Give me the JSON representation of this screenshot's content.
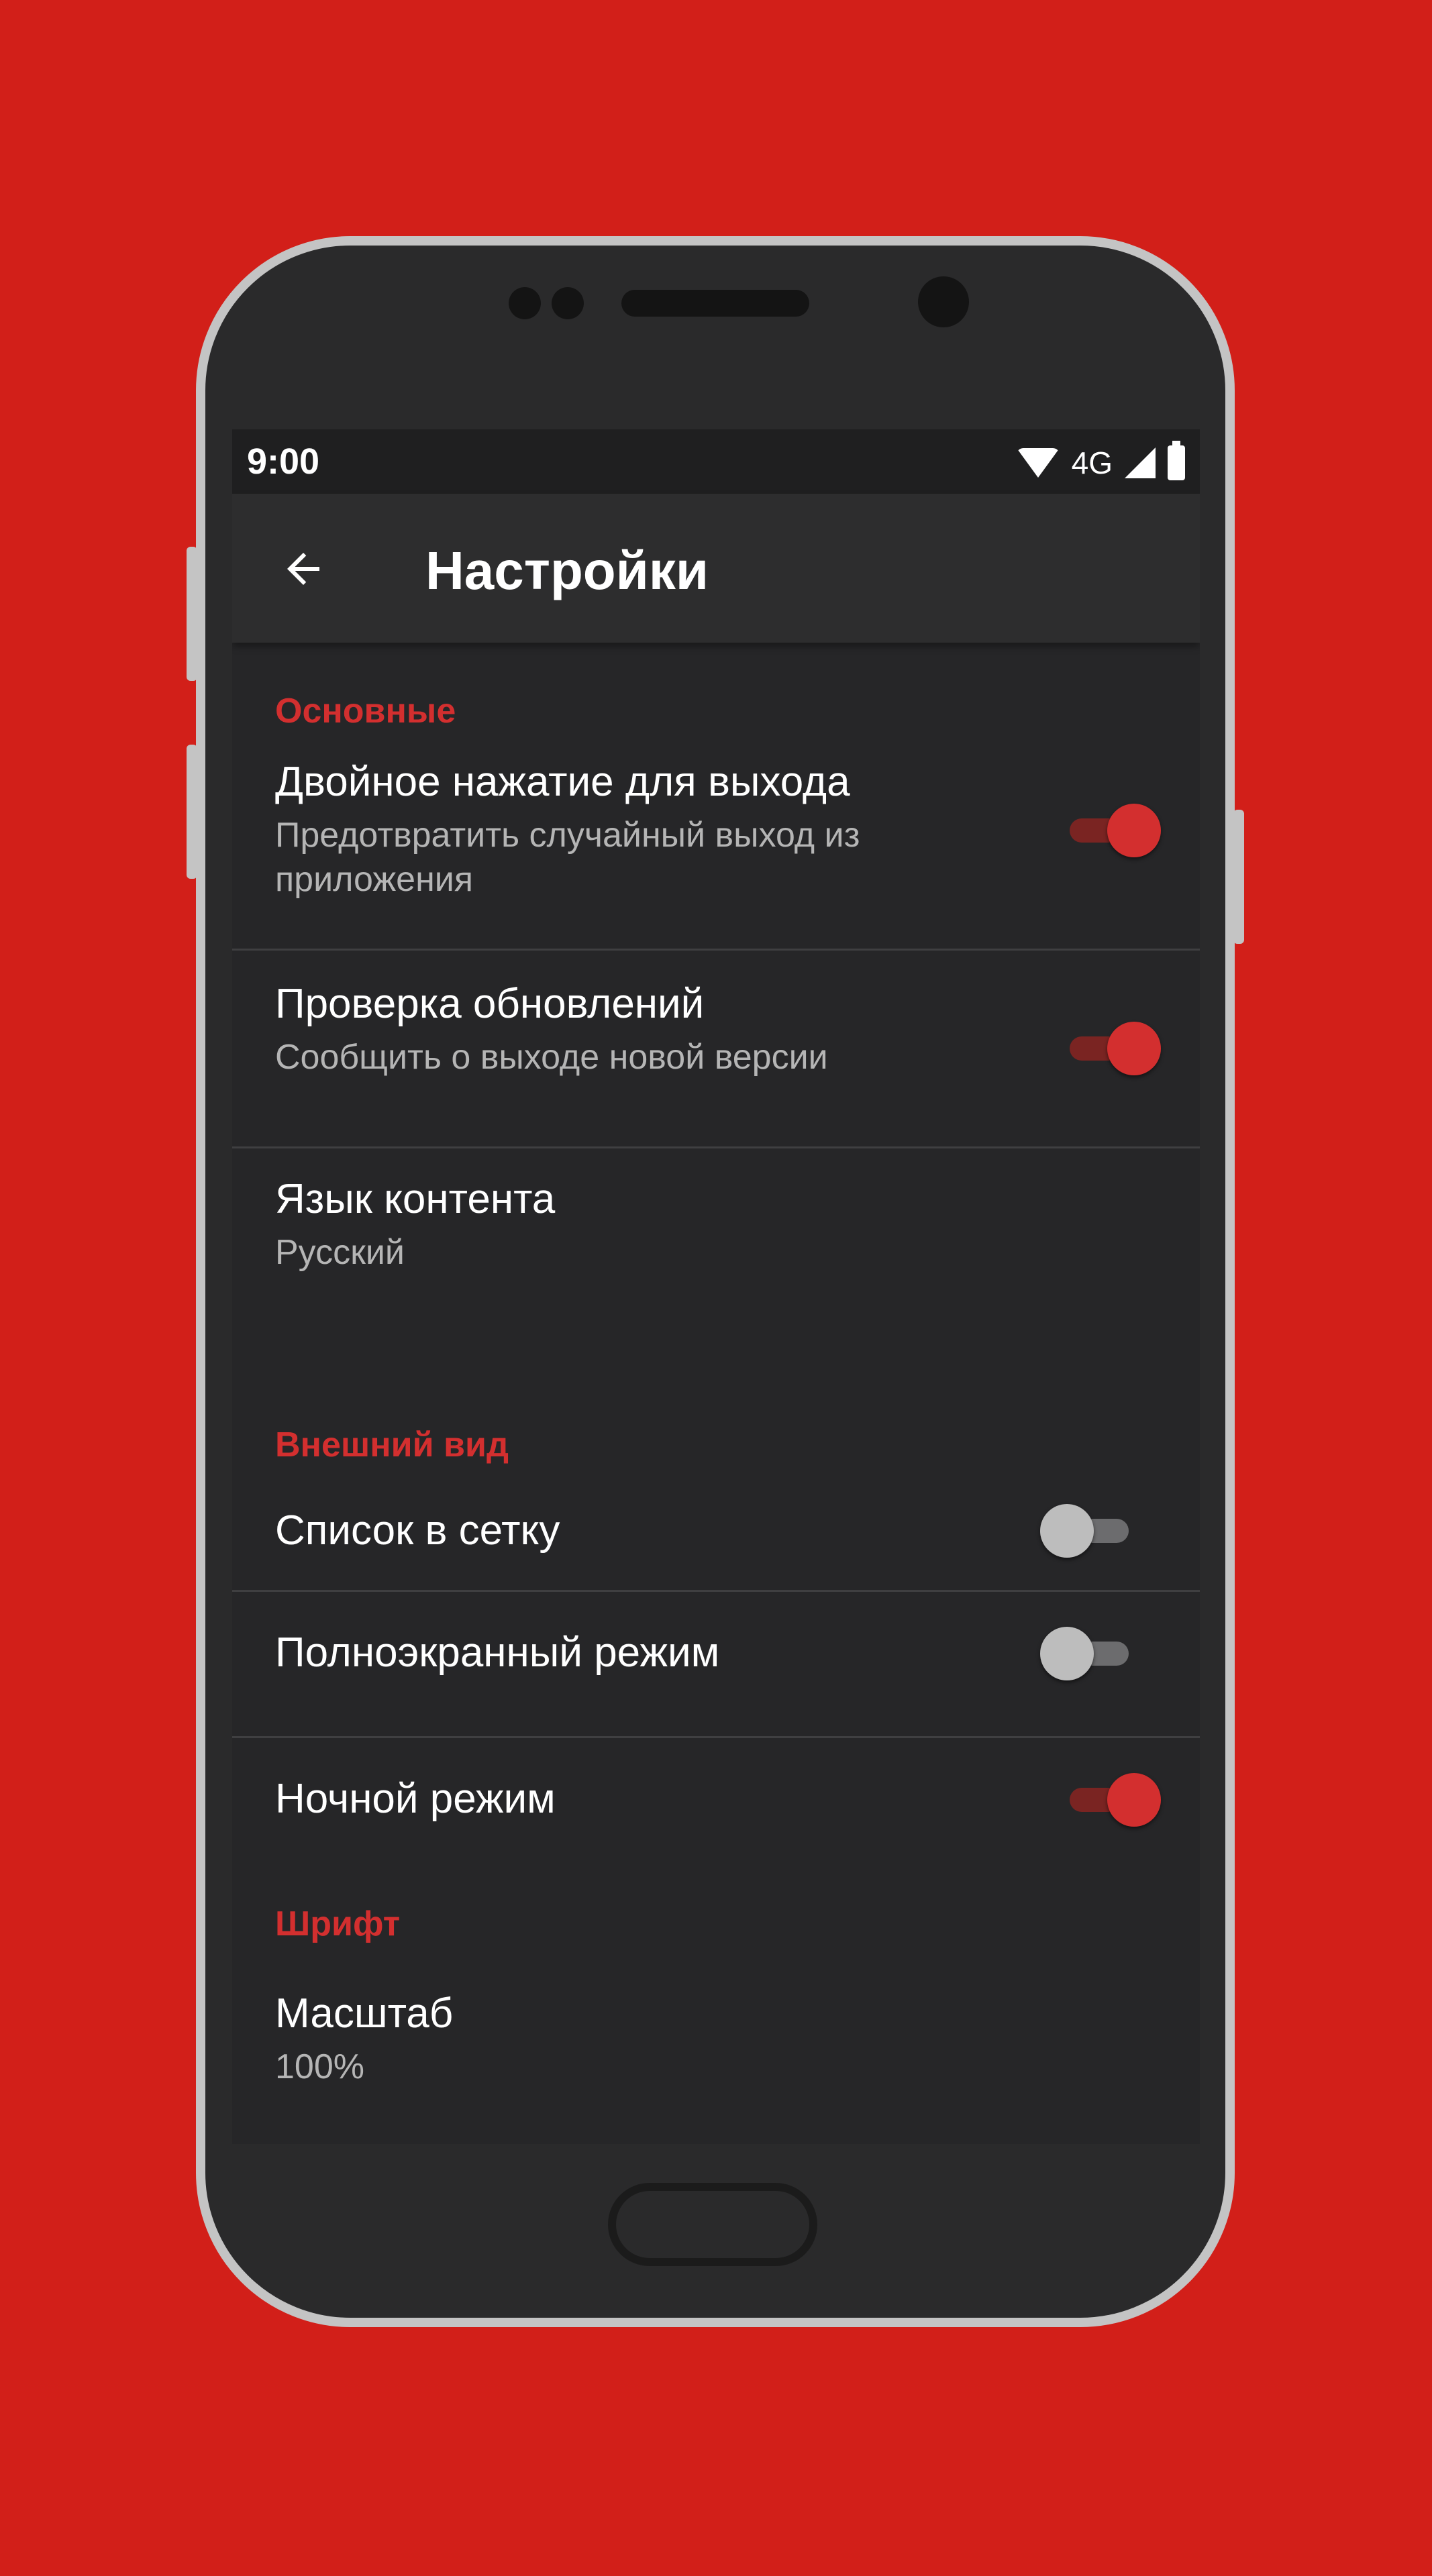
{
  "status": {
    "time": "9:00",
    "network": "4G"
  },
  "appbar": {
    "title": "Настройки"
  },
  "sections": {
    "general": "Основные",
    "appearance": "Внешний вид",
    "font": "Шрифт"
  },
  "items": {
    "double_tap_exit": {
      "title": "Двойное нажатие для выхода",
      "subtitle": "Предотвратить случайный выход из приложения",
      "enabled": true
    },
    "check_updates": {
      "title": "Проверка обновлений",
      "subtitle": "Сообщить о выходе новой версии",
      "enabled": true
    },
    "content_language": {
      "title": "Язык контента",
      "value": "Русский"
    },
    "grid_list": {
      "title": "Список в сетку",
      "enabled": false
    },
    "fullscreen": {
      "title": "Полноэкранный режим",
      "enabled": false
    },
    "night_mode": {
      "title": "Ночной режим",
      "enabled": true
    },
    "scale": {
      "title": "Масштаб",
      "value": "100%"
    }
  },
  "colors": {
    "background": "#d21f19",
    "accent": "#d32f2f",
    "screen": "#262628"
  }
}
